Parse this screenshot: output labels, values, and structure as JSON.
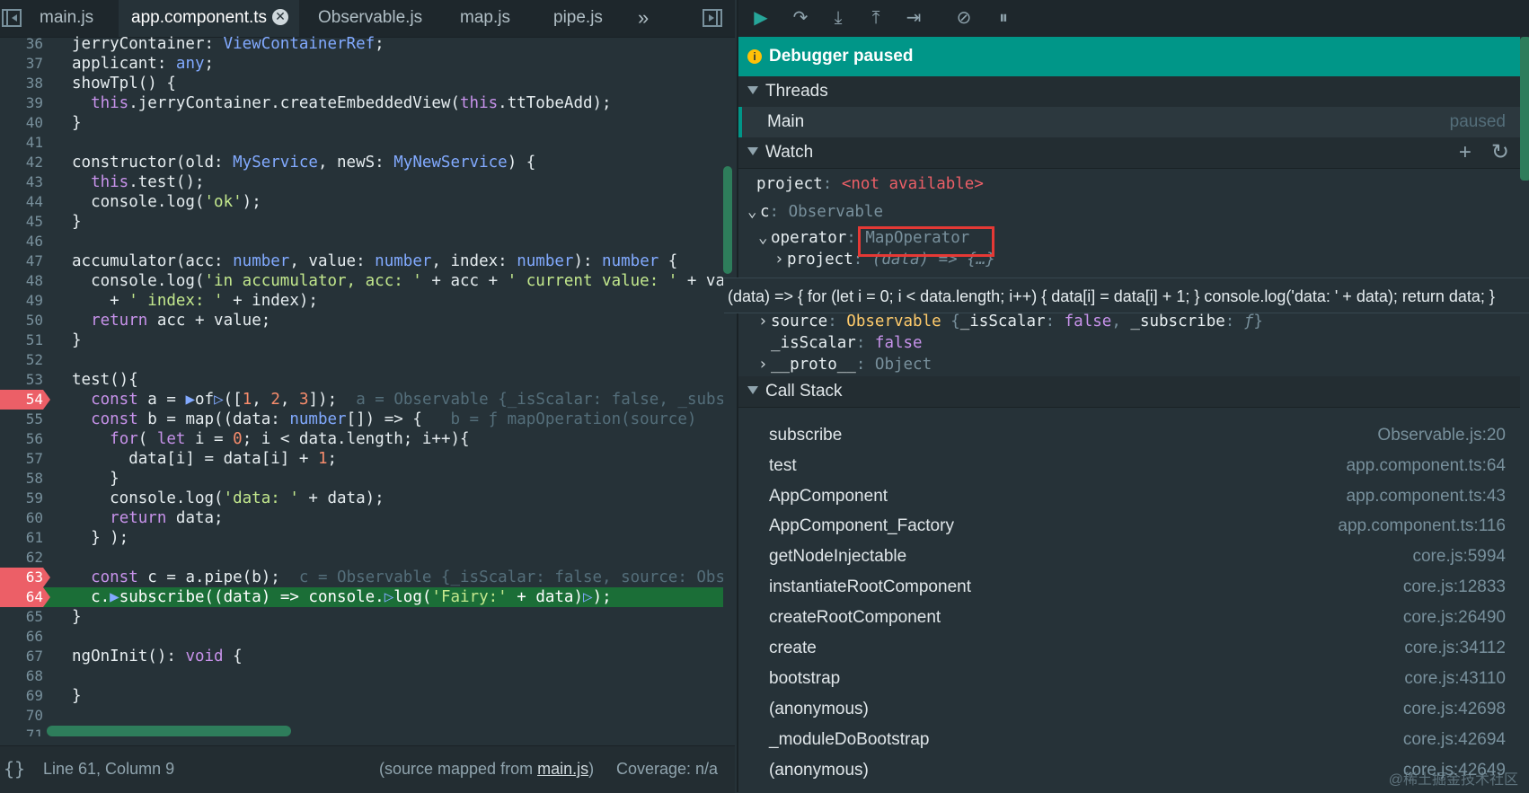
{
  "editor": {
    "tabs": [
      {
        "label": "main.js"
      },
      {
        "label": "app.component.ts",
        "active": true
      },
      {
        "label": "Observable.js"
      },
      {
        "label": "map.js"
      },
      {
        "label": "pipe.js"
      }
    ],
    "overflow_label": "»",
    "inline_values": {
      "l54": "a = Observable {_isScalar: false, _subs",
      "l55": "b = ƒ mapOperation(source)",
      "l63": "c = Observable {_isScalar: false, source: Obs"
    }
  },
  "status": {
    "position": "Line 61, Column 9",
    "source_prefix": "(source mapped from ",
    "source_file": "main.js",
    "source_suffix": ")",
    "coverage": "Coverage: n/a"
  },
  "debugger": {
    "banner": "Debugger paused",
    "threads_label": "Threads",
    "thread_name": "Main",
    "thread_status": "paused",
    "watch_label": "Watch",
    "callstack_label": "Call Stack",
    "tooltip": "(data) => { for (let i = 0; i < data.length; i++) { data[i] = data[i] + 1; } console.log('data: ' + data); return data; }",
    "watch": {
      "project_key": "project",
      "project_val": "<not available>",
      "c_key": "c",
      "c_val": "Observable",
      "operator_key": "operator",
      "operator_val": "MapOperator",
      "project2_key": "project",
      "project2_val": "(data) => {…}",
      "source_key": "source",
      "source_type": "Observable",
      "isScalar_key": "_isScalar",
      "isScalar_val": "false",
      "proto_key": "__proto__",
      "proto_val": "Object"
    },
    "frames": [
      {
        "fn": "subscribe",
        "loc": "Observable.js:20"
      },
      {
        "fn": "test",
        "loc": "app.component.ts:64"
      },
      {
        "fn": "AppComponent",
        "loc": "app.component.ts:43"
      },
      {
        "fn": "AppComponent_Factory",
        "loc": "app.component.ts:116"
      },
      {
        "fn": "getNodeInjectable",
        "loc": "core.js:5994"
      },
      {
        "fn": "instantiateRootComponent",
        "loc": "core.js:12833"
      },
      {
        "fn": "createRootComponent",
        "loc": "core.js:26490"
      },
      {
        "fn": "create",
        "loc": "core.js:34112"
      },
      {
        "fn": "bootstrap",
        "loc": "core.js:43110"
      },
      {
        "fn": "(anonymous)",
        "loc": "core.js:42698"
      },
      {
        "fn": "_moduleDoBootstrap",
        "loc": "core.js:42694"
      },
      {
        "fn": "(anonymous)",
        "loc": "core.js:42649"
      }
    ]
  },
  "watermark": "@稀土掘金技术社区",
  "colors": {
    "accent": "#009688",
    "breakpoint": "#ec5f67",
    "current_line": "#1b6e37",
    "highlight_box": "#e53935"
  }
}
